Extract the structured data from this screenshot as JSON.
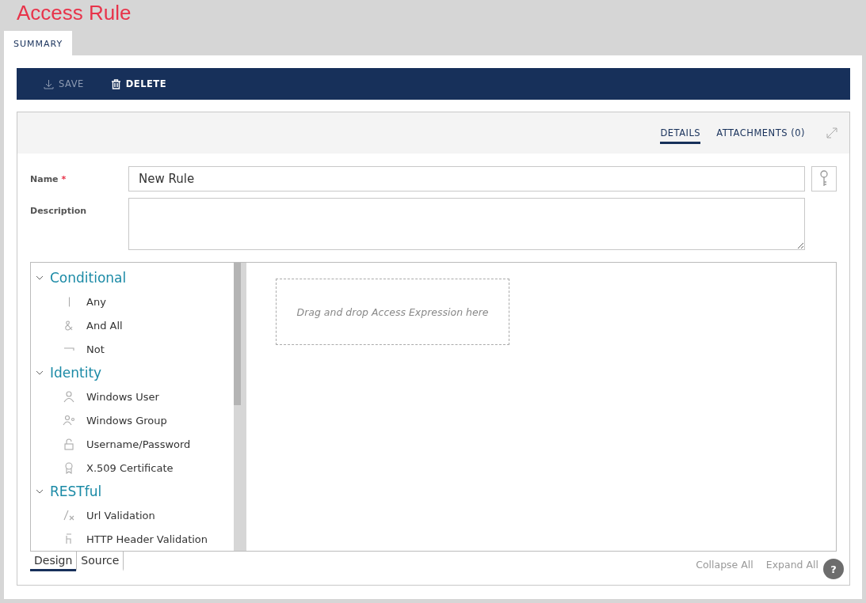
{
  "page_title": "Access Rule",
  "page_tabs": [
    {
      "label": "SUMMARY",
      "selected": true
    }
  ],
  "toolbar": [
    {
      "label": "SAVE",
      "kind": "save",
      "disabled": true
    },
    {
      "label": "DELETE",
      "kind": "delete",
      "disabled": false
    }
  ],
  "detail_tabs": [
    {
      "label": "DETAILS",
      "selected": true
    },
    {
      "label": "ATTACHMENTS (0)",
      "selected": false
    }
  ],
  "form": {
    "name": {
      "label": "Name",
      "required": true,
      "required_mark": "*",
      "value": "New Rule"
    },
    "description": {
      "label": "Description"
    }
  },
  "palette": [
    {
      "label": "Conditional",
      "expanded": true,
      "children": [
        {
          "label": "Any",
          "kind": "or"
        },
        {
          "label": "And All",
          "kind": "and"
        },
        {
          "label": "Not",
          "kind": "not"
        }
      ]
    },
    {
      "label": "Identity",
      "expanded": true,
      "children": [
        {
          "label": "Windows User",
          "kind": "user"
        },
        {
          "label": "Windows Group",
          "kind": "group"
        },
        {
          "label": "Username/Password",
          "kind": "lock"
        },
        {
          "label": "X.509 Certificate",
          "kind": "certificate"
        }
      ]
    },
    {
      "label": "RESTful",
      "expanded": true,
      "children": [
        {
          "label": "Url Validation",
          "kind": "url"
        },
        {
          "label": "HTTP Header Validation",
          "kind": "header"
        }
      ]
    }
  ],
  "drop_zone": "Drag and drop Access Expression here",
  "view_tabs": [
    {
      "label": "Design",
      "selected": true
    },
    {
      "label": "Source",
      "selected": false
    }
  ],
  "footer_links": [
    "Collapse All",
    "Expand All"
  ],
  "help": "?"
}
